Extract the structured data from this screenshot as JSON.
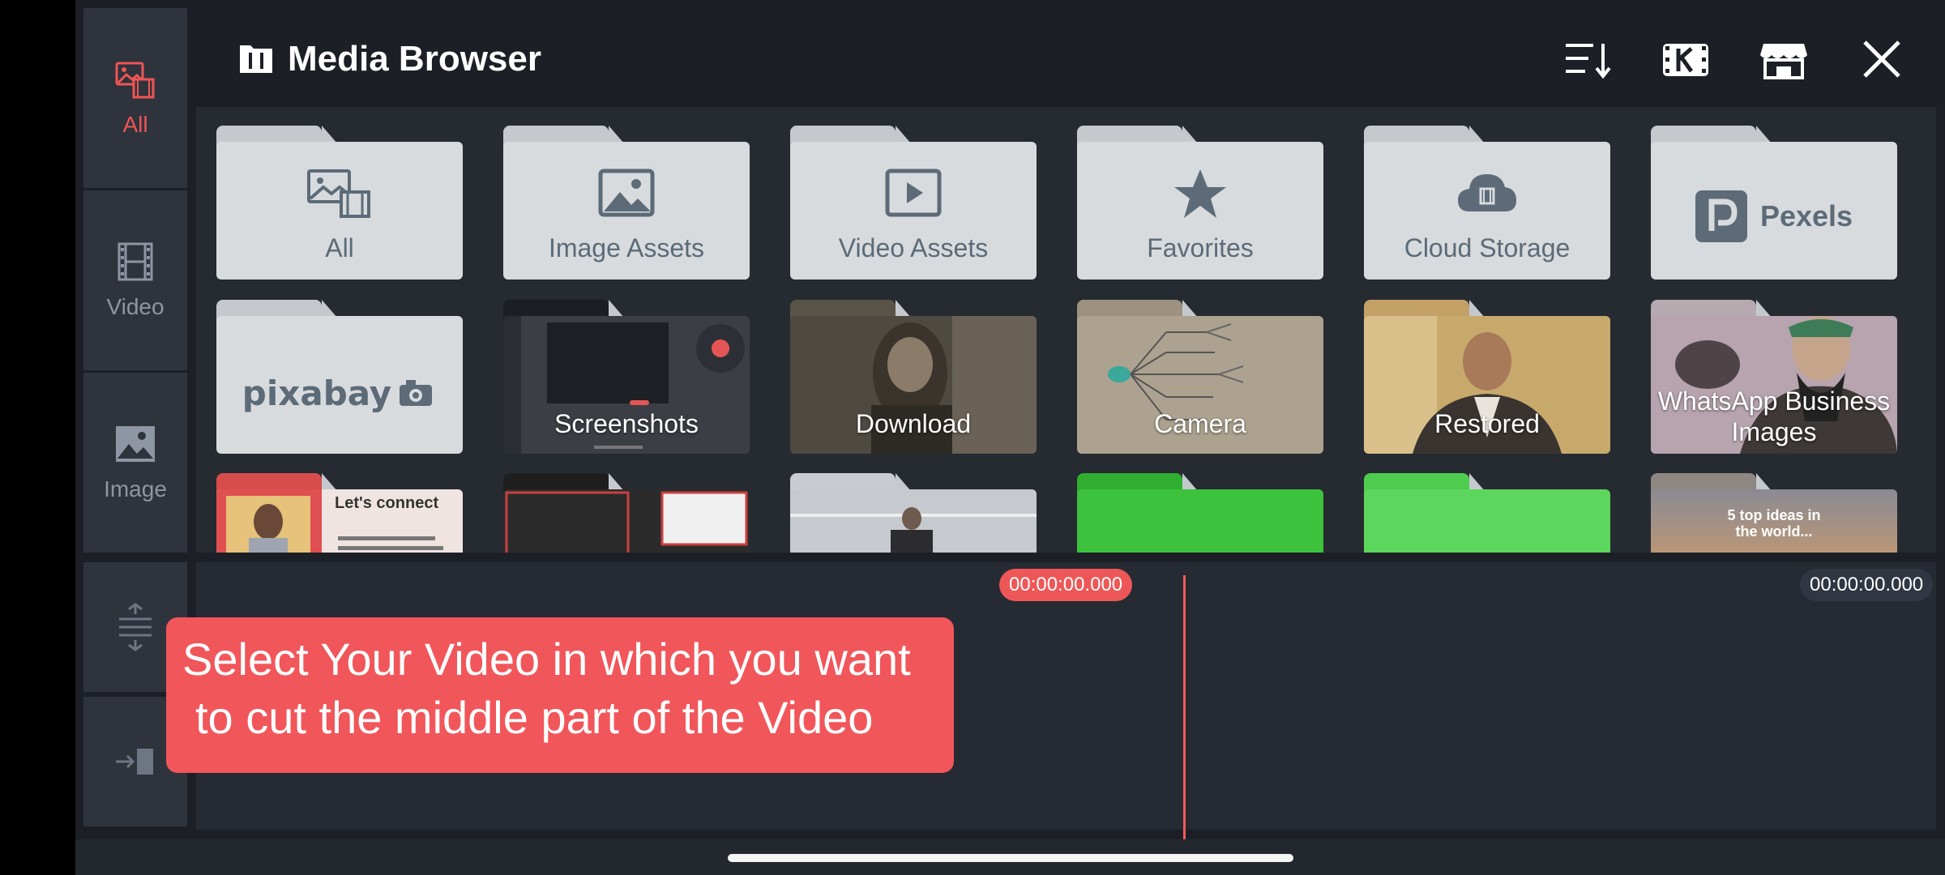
{
  "header": {
    "title": "Media Browser"
  },
  "side_tabs": [
    {
      "label": "All",
      "icon": "all-media-icon",
      "active": true
    },
    {
      "label": "Video",
      "icon": "film-icon"
    },
    {
      "label": "Image",
      "icon": "image-icon"
    }
  ],
  "header_actions": [
    "sort-icon",
    "kinemaster-icon",
    "store-icon",
    "close-icon"
  ],
  "folders": [
    {
      "label": "All",
      "icon": "all-media-icon"
    },
    {
      "label": "Image Assets",
      "icon": "image-icon"
    },
    {
      "label": "Video Assets",
      "icon": "play-icon"
    },
    {
      "label": "Favorites",
      "icon": "star-icon"
    },
    {
      "label": "Cloud Storage",
      "icon": "cloud-icon"
    },
    {
      "label": "Pexels",
      "icon": "pexels-logo"
    },
    {
      "label": "pixabay",
      "icon": "pixabay-logo"
    },
    {
      "label": "Screenshots"
    },
    {
      "label": "Download"
    },
    {
      "label": "Camera"
    },
    {
      "label": "Restored"
    },
    {
      "label": "WhatsApp Business Images"
    }
  ],
  "partial_row": {
    "folder_1_text": "Let's connect",
    "folder_6_text": "5 top ideas in the world..."
  },
  "timeline": {
    "current_time": "00:00:00.000",
    "total_time": "00:00:00.000"
  },
  "tooltip": {
    "line1": "Select Your Video in which you want",
    "line2": "to cut the middle part of the Video"
  },
  "colors": {
    "accent": "#ee5555",
    "background": "#1c1f26",
    "folder": "#d8dbde",
    "green_folder": "#3cc23c"
  }
}
